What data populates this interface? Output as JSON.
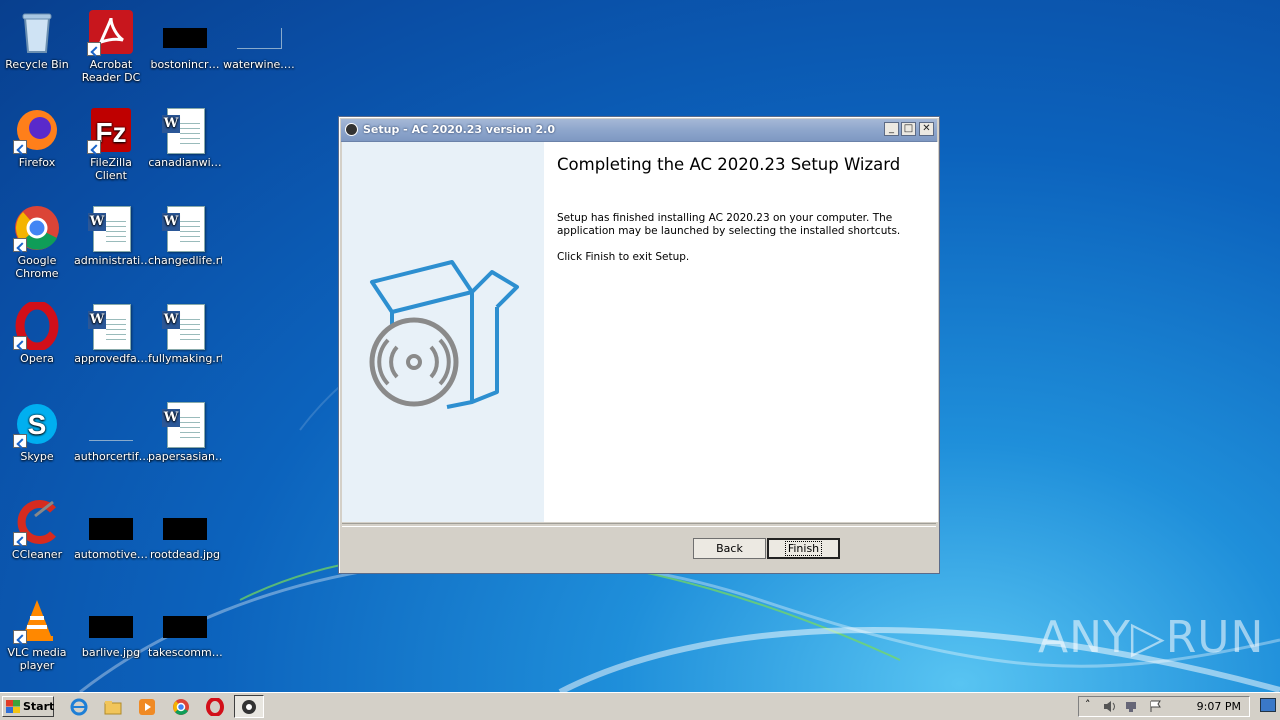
{
  "desktop": {
    "icons": [
      {
        "label": "Recycle Bin",
        "icon": "recycle-bin-icon"
      },
      {
        "label": "Acrobat Reader DC",
        "icon": "acrobat-icon"
      },
      {
        "label": "bostonincr…",
        "icon": "file-icon"
      },
      {
        "label": "waterwine.…",
        "icon": "file-icon"
      },
      {
        "label": "Firefox",
        "icon": "firefox-icon"
      },
      {
        "label": "FileZilla Client",
        "icon": "filezilla-icon"
      },
      {
        "label": "canadianwi…",
        "icon": "word-doc-icon"
      },
      {
        "label": "Google Chrome",
        "icon": "chrome-icon"
      },
      {
        "label": "administrati…",
        "icon": "word-doc-icon"
      },
      {
        "label": "changedlife.rtf",
        "icon": "word-doc-icon"
      },
      {
        "label": "Opera",
        "icon": "opera-icon"
      },
      {
        "label": "approvedfa…",
        "icon": "word-doc-icon"
      },
      {
        "label": "fullymaking.rtf",
        "icon": "word-doc-icon"
      },
      {
        "label": "Skype",
        "icon": "skype-icon"
      },
      {
        "label": "authorcertif…",
        "icon": "file-icon"
      },
      {
        "label": "papersasian…",
        "icon": "word-doc-icon"
      },
      {
        "label": "CCleaner",
        "icon": "ccleaner-icon"
      },
      {
        "label": "automotive…",
        "icon": "image-icon"
      },
      {
        "label": "rootdead.jpg",
        "icon": "image-icon"
      },
      {
        "label": "VLC media player",
        "icon": "vlc-icon"
      },
      {
        "label": "barlive.jpg",
        "icon": "image-icon"
      },
      {
        "label": "takescomm…",
        "icon": "image-icon"
      }
    ]
  },
  "window": {
    "title": "Setup - AC 2020.23 version 2.0",
    "heading": "Completing the AC 2020.23 Setup Wizard",
    "paragraph1": "Setup has finished installing AC 2020.23 on your computer. The application may be launched by selecting the installed shortcuts.",
    "paragraph2": "Click Finish to exit Setup.",
    "back_label": "Back",
    "finish_label": "Finish",
    "minimize_glyph": "_",
    "maximize_glyph": "□",
    "close_glyph": "✕"
  },
  "taskbar": {
    "start_label": "Start",
    "clock": "9:07 PM",
    "pinned": [
      "ie-icon",
      "explorer-icon",
      "media-player-icon",
      "chrome-icon",
      "opera-icon",
      "setup-icon"
    ]
  },
  "watermark": "ANY▷RUN",
  "colors": {
    "desktop_bg": "#0c63bd",
    "titlebar": "#8ea6cc",
    "left_panel": "#e8f1f8",
    "box_art": "#2d8fd0"
  }
}
